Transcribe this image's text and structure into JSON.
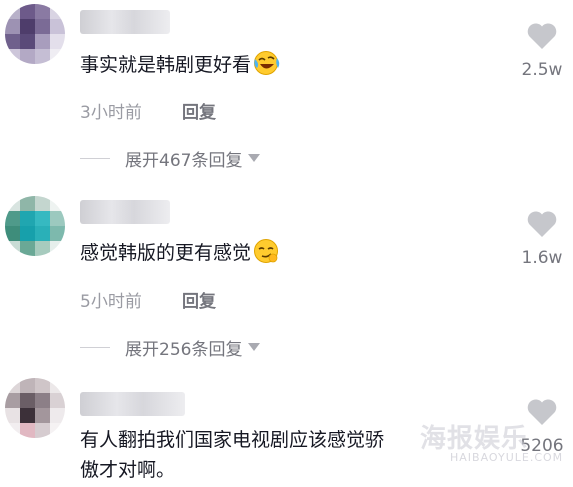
{
  "comments": [
    {
      "text": "事实就是韩剧更好看",
      "emoji": "laughing-crying-emoji",
      "time": "3小时前",
      "reply_label": "回复",
      "expand_label": "展开467条回复",
      "likes": "2.5w"
    },
    {
      "text": "感觉韩版的更有感觉",
      "emoji": "smirking-emoji",
      "time": "5小时前",
      "reply_label": "回复",
      "expand_label": "展开256条回复",
      "likes": "1.6w"
    },
    {
      "text_line1": "有人翻拍我们国家电视剧应该感觉骄",
      "text_line2": "傲才对啊。",
      "likes": "5206"
    }
  ],
  "watermark": {
    "title": "海报娱乐",
    "url": "HAIBAOYULE.COM"
  },
  "colors": {
    "text": "#161823",
    "meta": "#9a9ba3",
    "like_icon": "#c6c7cc"
  }
}
